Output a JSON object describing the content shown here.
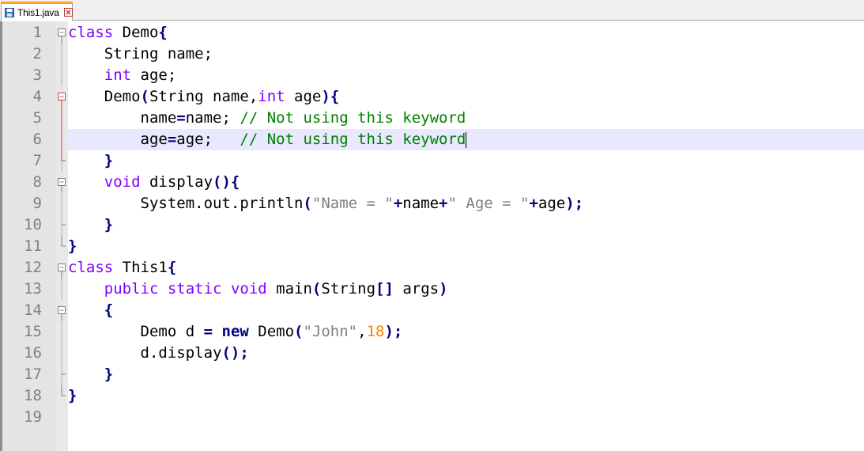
{
  "tab": {
    "label": "This1.java",
    "file_icon": "save-file-icon",
    "close_icon": "close-icon"
  },
  "colors": {
    "keyword": "#8000ff",
    "operator": "#000080",
    "comment": "#008000",
    "string": "#808080",
    "number": "#ff8000",
    "line_number": "#808080",
    "current_line": "#e8e8ff",
    "gutter": "#e4e4e4",
    "tab_accent": "#f5a623",
    "fold_active": "#d04040"
  },
  "editor": {
    "current_line": 6,
    "lines": [
      {
        "num": "1",
        "fold": "box-minus",
        "tokens": [
          {
            "t": "class",
            "k": "keyword"
          },
          {
            "t": " Demo",
            "k": "text"
          },
          {
            "t": "{",
            "k": "op"
          }
        ]
      },
      {
        "num": "2",
        "fold": "line",
        "tokens": [
          {
            "t": "    String name;",
            "k": "text"
          }
        ]
      },
      {
        "num": "3",
        "fold": "line",
        "tokens": [
          {
            "t": "    ",
            "k": "text"
          },
          {
            "t": "int",
            "k": "keyword"
          },
          {
            "t": " age;",
            "k": "text"
          }
        ]
      },
      {
        "num": "4",
        "fold": "box-minus-red",
        "tokens": [
          {
            "t": "    Demo",
            "k": "text"
          },
          {
            "t": "(",
            "k": "op"
          },
          {
            "t": "String name",
            "k": "text"
          },
          {
            "t": ",",
            "k": "text"
          },
          {
            "t": "int",
            "k": "keyword"
          },
          {
            "t": " age",
            "k": "text"
          },
          {
            "t": "){",
            "k": "op"
          }
        ]
      },
      {
        "num": "5",
        "fold": "line-red",
        "tokens": [
          {
            "t": "        name",
            "k": "text"
          },
          {
            "t": "=",
            "k": "op"
          },
          {
            "t": "name; ",
            "k": "text"
          },
          {
            "t": "// Not using this keyword",
            "k": "comment"
          }
        ]
      },
      {
        "num": "6",
        "fold": "line-red",
        "tokens": [
          {
            "t": "        age",
            "k": "text"
          },
          {
            "t": "=",
            "k": "op"
          },
          {
            "t": "age;   ",
            "k": "text"
          },
          {
            "t": "// Not using this keyword",
            "k": "comment"
          }
        ]
      },
      {
        "num": "7",
        "fold": "end-red",
        "tokens": [
          {
            "t": "    ",
            "k": "text"
          },
          {
            "t": "}",
            "k": "op"
          }
        ]
      },
      {
        "num": "8",
        "fold": "box-minus",
        "tokens": [
          {
            "t": "    ",
            "k": "text"
          },
          {
            "t": "void",
            "k": "keyword"
          },
          {
            "t": " display",
            "k": "text"
          },
          {
            "t": "(){",
            "k": "op"
          }
        ]
      },
      {
        "num": "9",
        "fold": "line",
        "tokens": [
          {
            "t": "        System.out.println",
            "k": "text"
          },
          {
            "t": "(",
            "k": "op"
          },
          {
            "t": "\"Name = \"",
            "k": "string"
          },
          {
            "t": "+",
            "k": "op"
          },
          {
            "t": "name",
            "k": "text"
          },
          {
            "t": "+",
            "k": "op"
          },
          {
            "t": "\" Age = \"",
            "k": "string"
          },
          {
            "t": "+",
            "k": "op"
          },
          {
            "t": "age",
            "k": "text"
          },
          {
            "t": ");",
            "k": "op"
          }
        ]
      },
      {
        "num": "10",
        "fold": "end",
        "tokens": [
          {
            "t": "    ",
            "k": "text"
          },
          {
            "t": "}",
            "k": "op"
          }
        ]
      },
      {
        "num": "11",
        "fold": "end-corner",
        "tokens": [
          {
            "t": "}",
            "k": "op"
          }
        ]
      },
      {
        "num": "12",
        "fold": "box-minus",
        "tokens": [
          {
            "t": "class",
            "k": "keyword"
          },
          {
            "t": " This1",
            "k": "text"
          },
          {
            "t": "{",
            "k": "op"
          }
        ]
      },
      {
        "num": "13",
        "fold": "line",
        "tokens": [
          {
            "t": "    ",
            "k": "text"
          },
          {
            "t": "public",
            "k": "keyword"
          },
          {
            "t": " ",
            "k": "text"
          },
          {
            "t": "static",
            "k": "keyword"
          },
          {
            "t": " ",
            "k": "text"
          },
          {
            "t": "void",
            "k": "keyword"
          },
          {
            "t": " main",
            "k": "text"
          },
          {
            "t": "(",
            "k": "op"
          },
          {
            "t": "String",
            "k": "text"
          },
          {
            "t": "[]",
            "k": "op"
          },
          {
            "t": " args",
            "k": "text"
          },
          {
            "t": ")",
            "k": "op"
          }
        ]
      },
      {
        "num": "14",
        "fold": "box-minus",
        "tokens": [
          {
            "t": "    ",
            "k": "text"
          },
          {
            "t": "{",
            "k": "op"
          }
        ]
      },
      {
        "num": "15",
        "fold": "line",
        "tokens": [
          {
            "t": "        Demo d ",
            "k": "text"
          },
          {
            "t": "=",
            "k": "op"
          },
          {
            "t": " ",
            "k": "text"
          },
          {
            "t": "new",
            "k": "bold"
          },
          {
            "t": " Demo",
            "k": "text"
          },
          {
            "t": "(",
            "k": "op"
          },
          {
            "t": "\"John\"",
            "k": "string"
          },
          {
            "t": ",",
            "k": "text"
          },
          {
            "t": "18",
            "k": "number"
          },
          {
            "t": ");",
            "k": "op"
          }
        ]
      },
      {
        "num": "16",
        "fold": "line",
        "tokens": [
          {
            "t": "        d.display",
            "k": "text"
          },
          {
            "t": "();",
            "k": "op"
          }
        ]
      },
      {
        "num": "17",
        "fold": "end",
        "tokens": [
          {
            "t": "    ",
            "k": "text"
          },
          {
            "t": "}",
            "k": "op"
          }
        ]
      },
      {
        "num": "18",
        "fold": "end-corner",
        "tokens": [
          {
            "t": "}",
            "k": "op"
          }
        ]
      },
      {
        "num": "19",
        "fold": "none",
        "tokens": []
      }
    ]
  }
}
